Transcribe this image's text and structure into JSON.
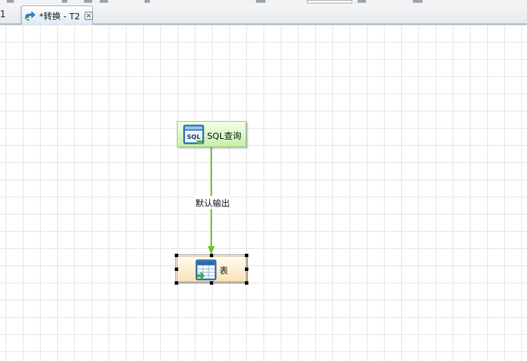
{
  "tabs": [
    {
      "label": "1"
    },
    {
      "label": "*转换 - T2"
    }
  ],
  "steps": [
    {
      "label": "SQL查询",
      "icon": "sql-icon",
      "badge": "SQL"
    },
    {
      "label": "表",
      "icon": "table-output-icon"
    }
  ],
  "hop": {
    "label": "默认输出"
  },
  "colors": {
    "hop_line": "#66c71a",
    "sql_step_fill": "#d7f5c0",
    "table_step_fill": "#fbe7c0",
    "grid": "#e4e4e4"
  }
}
